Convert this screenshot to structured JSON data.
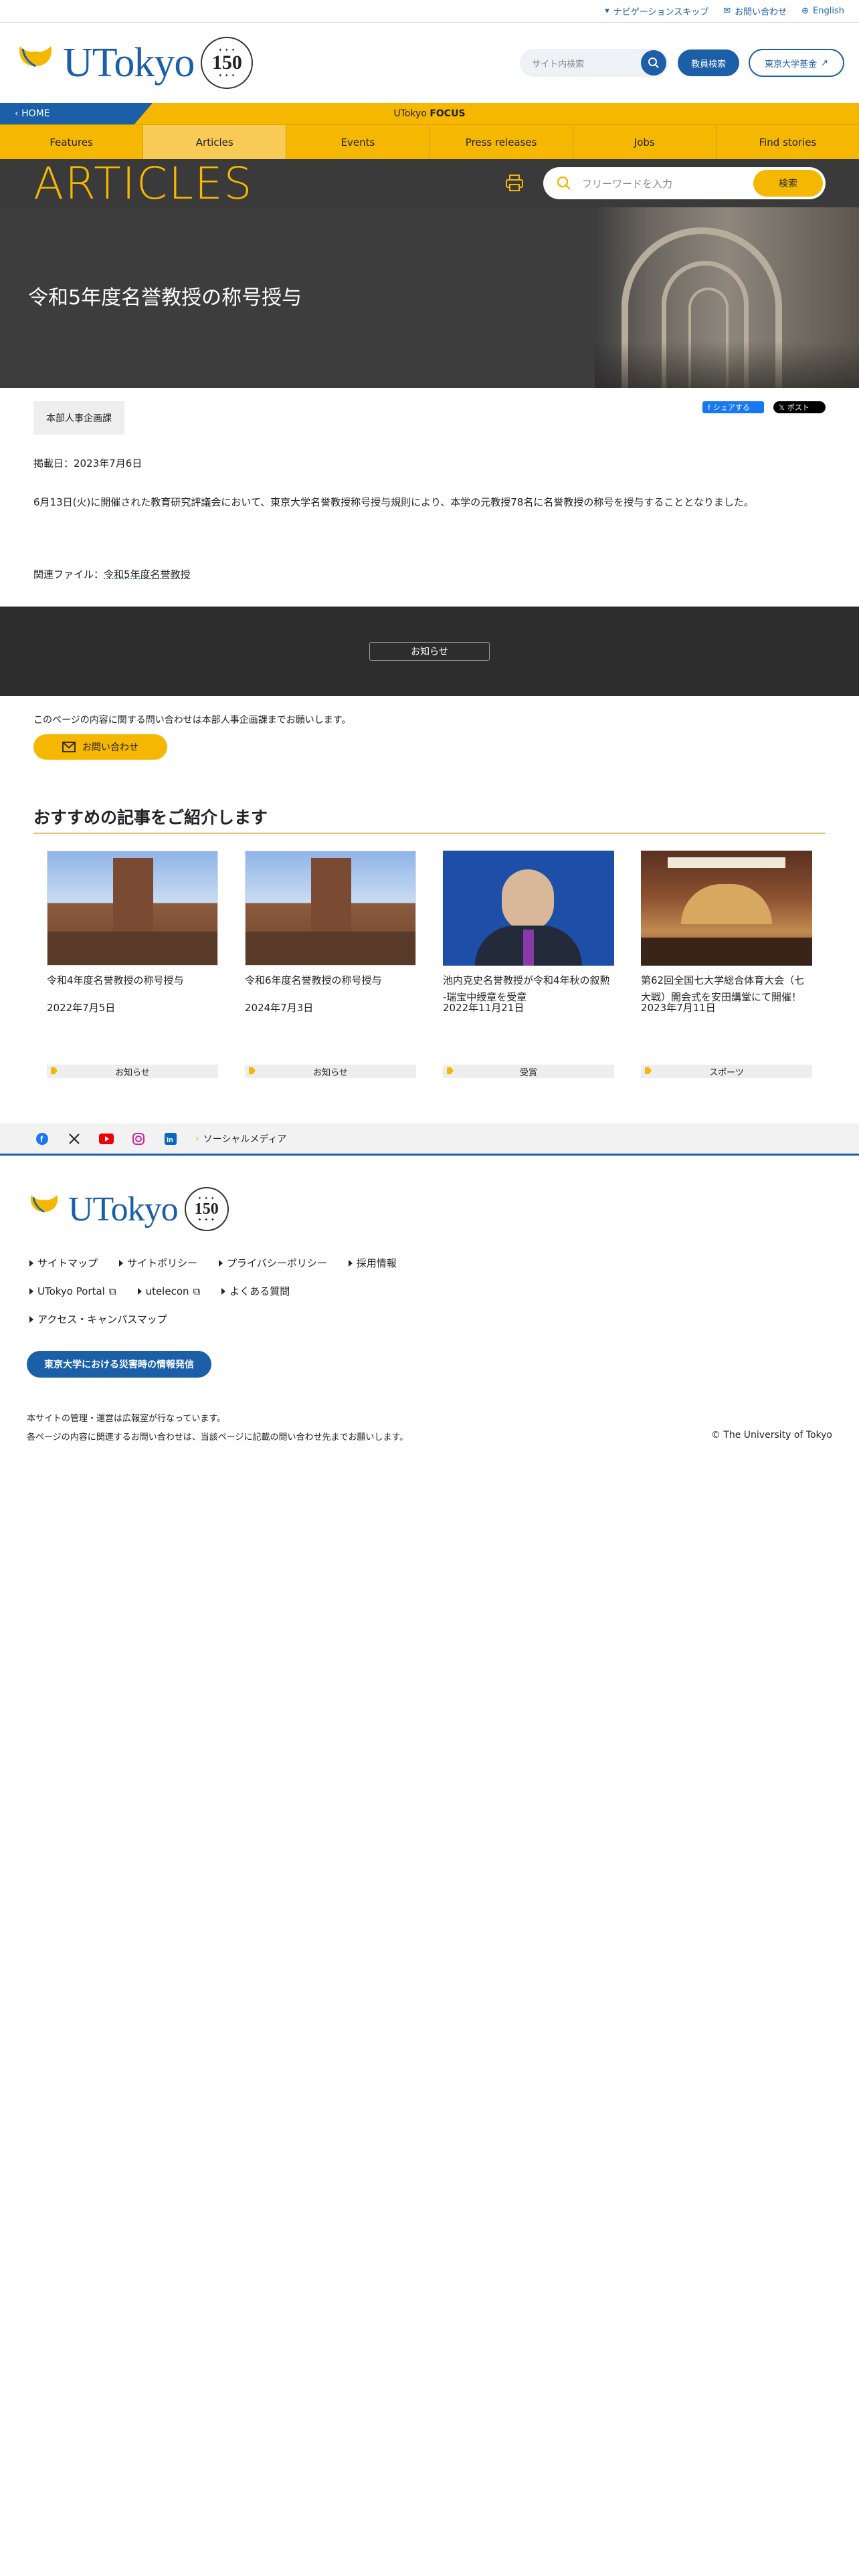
{
  "util": {
    "nav_skip": "ナビゲーションスキップ",
    "contact": "お問い合わせ",
    "english": "English"
  },
  "header": {
    "logo_text": "UTokyo",
    "seal_number": "150",
    "search_placeholder": "サイト内検索",
    "faculty_search": "教員検索",
    "fund": "東京大学基金"
  },
  "focus": {
    "home": "HOME",
    "prefix": "UTokyo",
    "brand": "FOCUS"
  },
  "nav": [
    "Features",
    "Articles",
    "Events",
    "Press releases",
    "Jobs",
    "Find stories"
  ],
  "articles": {
    "title": "ARTICLES",
    "search_placeholder": "フリーワードを入力",
    "search_button": "検索"
  },
  "hero": {
    "title": "令和5年度名誉教授の称号授与"
  },
  "article": {
    "department": "本部人事企画課",
    "share_fb": "シェアする",
    "share_x": "ポスト",
    "date": "掲載日：2023年7月6日",
    "body": "6月13日(火)に開催された教育研究評議会において、東京大学名誉教授称号授与規則により、本学の元教授78名に名誉教授の称号を授与することとなりました。",
    "file_label": "関連ファイル：",
    "file_link": "令和5年度名誉教授"
  },
  "notice": {
    "button": "お知らせ"
  },
  "contact": {
    "text": "このページの内容に関する問い合わせは本部人事企画課までお願いします。",
    "button": "お問い合わせ"
  },
  "recommend": {
    "title": "おすすめの記事をご紹介します",
    "cards": [
      {
        "title": "令和4年度名誉教授の称号授与",
        "date": "2022年7月5日",
        "category": "お知らせ"
      },
      {
        "title": "令和6年度名誉教授の称号授与",
        "date": "2024年7月3日",
        "category": "お知らせ"
      },
      {
        "title": "池内克史名誉教授が令和4年秋の叙勲 -瑞宝中綬章を受章",
        "date": "2022年11月21日",
        "category": "受賞"
      },
      {
        "title": "第62回全国七大学総合体育大会（七大戦）開会式を安田講堂にて開催！",
        "date": "2023年7月11日",
        "category": "スポーツ"
      }
    ]
  },
  "social": {
    "label": "ソーシャルメディア"
  },
  "footer": {
    "logo_text": "UTokyo",
    "seal_number": "150",
    "links_row1": [
      "サイトマップ",
      "サイトポリシー",
      "プライバシーポリシー",
      "採用情報"
    ],
    "links_row2": [
      "UTokyo Portal",
      "utelecon",
      "よくある質問"
    ],
    "links_row3": [
      "アクセス・キャンパスマップ"
    ],
    "disaster": "東京大学における災害時の情報発信",
    "note1": "本サイトの管理・運営は広報室が行なっています。",
    "note2": "各ページの内容に関連するお問い合わせは、当該ページに記載の問い合わせ先までお願いします。",
    "copyright": "© The University of Tokyo"
  },
  "colors": {
    "brand_blue": "#1a5fa8",
    "brand_yellow": "#f5b700",
    "dark": "#3a3a3a"
  }
}
